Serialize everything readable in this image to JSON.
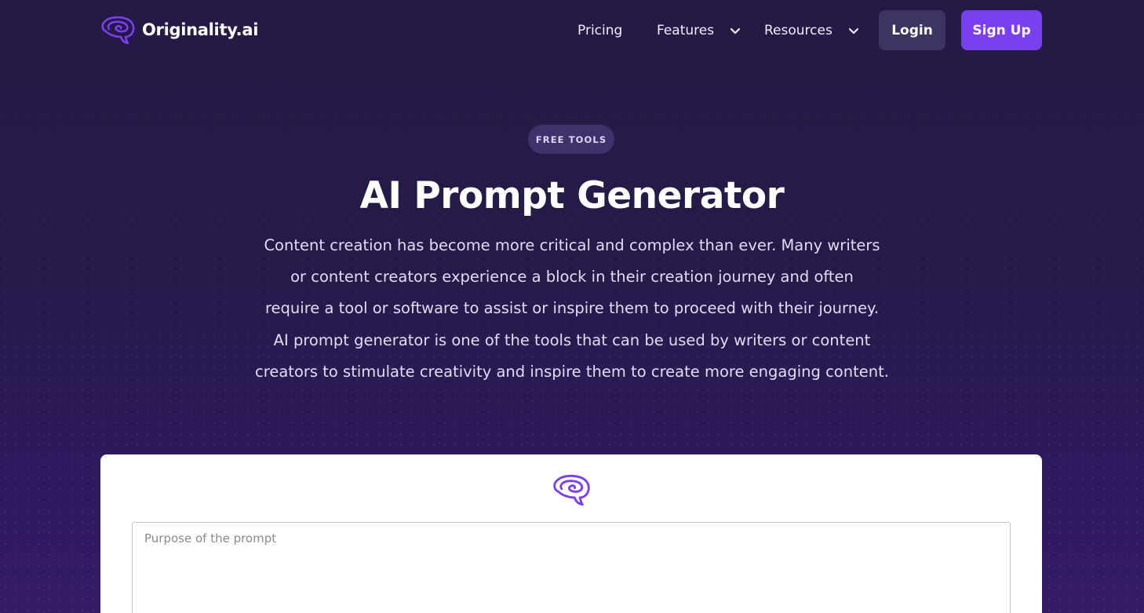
{
  "brand": {
    "name": "Originality.ai",
    "icon": "brain-icon"
  },
  "nav": {
    "pricing": "Pricing",
    "features": "Features",
    "resources": "Resources",
    "dropdown_icon": "chevron-down-icon"
  },
  "auth": {
    "login": "Login",
    "signup": "Sign Up"
  },
  "hero": {
    "badge": "FREE TOOLS",
    "title": "AI Prompt Generator",
    "description_lines": [
      "Content creation has become more critical and complex than ever. Many writers",
      "or content creators experience a block in their creation journey and often",
      "require a tool or software to assist or inspire them to proceed with their journey.",
      "AI prompt generator is one of the tools that can be used by writers or content",
      "creators to stimulate creativity and inspire them to create more engaging content."
    ]
  },
  "tool": {
    "icon": "brain-icon",
    "purpose_placeholder": "Purpose of the prompt",
    "purpose_value": ""
  },
  "colors": {
    "background_top": "#251a45",
    "background_bottom": "#341b68",
    "accent": "#7b3ff2",
    "login_button": "#3e3463",
    "badge_background": "#40316c"
  }
}
